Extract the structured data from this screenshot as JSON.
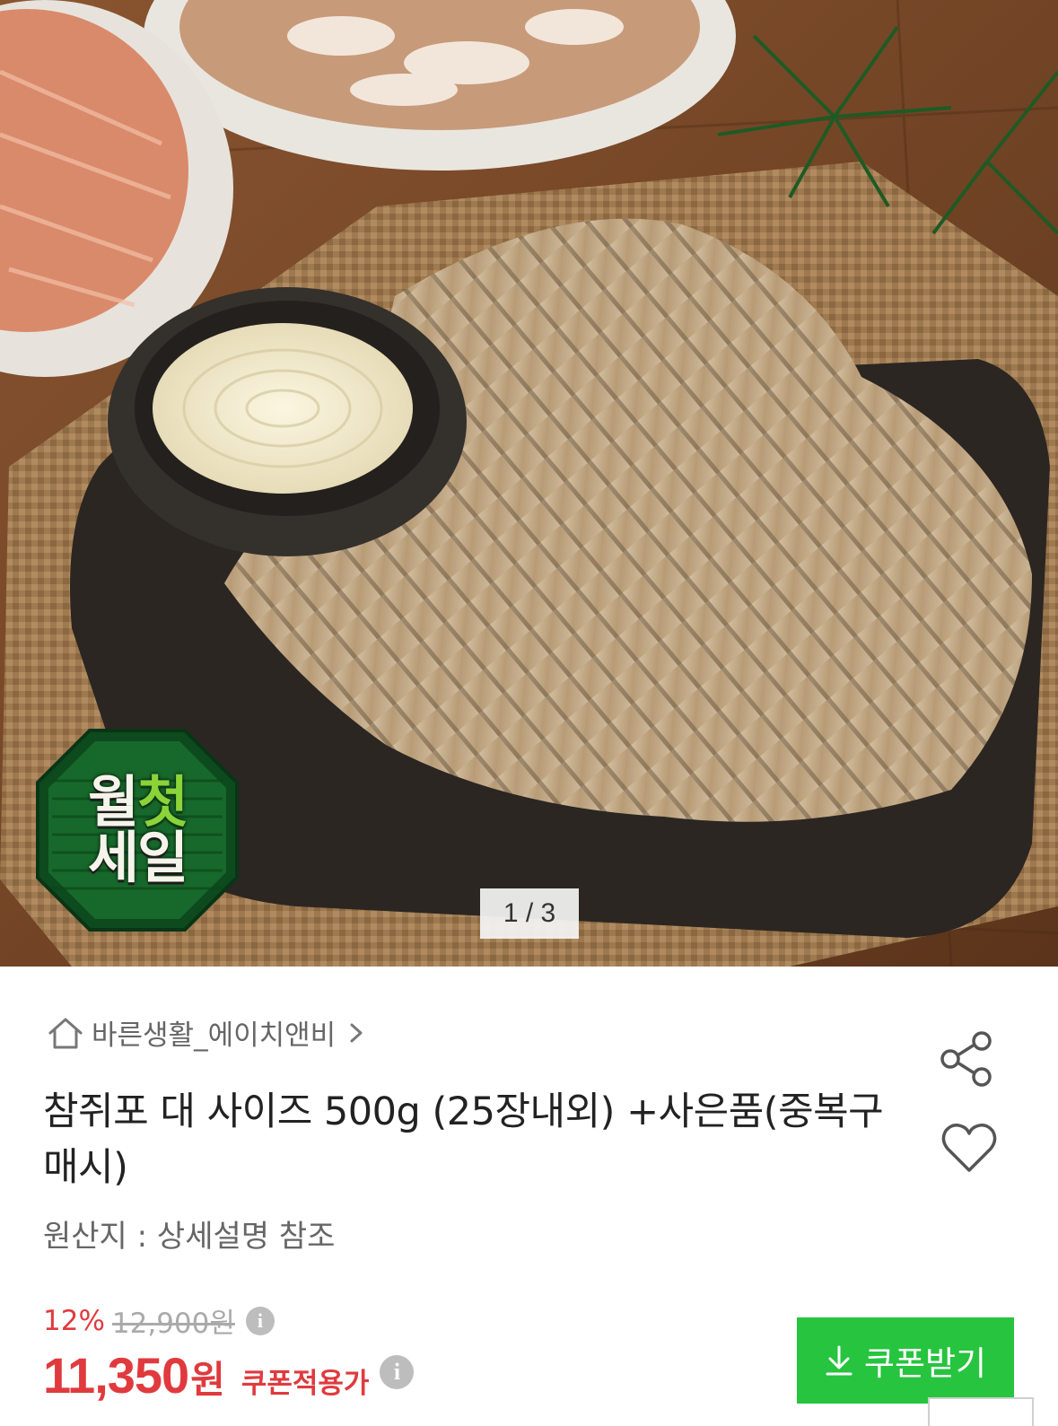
{
  "gallery": {
    "pager_text": "1 / 3",
    "badge_line1_a": "월",
    "badge_line1_b": "첫",
    "badge_line2": "세일"
  },
  "product": {
    "seller": "바른생활_에이치앤비",
    "title": "참쥐포 대 사이즈 500g (25장내외) +사은품(중복구매시)",
    "origin": "원산지 : 상세설명 참조"
  },
  "pricing": {
    "discount_percent": "12%",
    "original_price": "12,900원",
    "final_price": "11,350",
    "final_unit": "원",
    "coupon_note": "쿠폰적용가",
    "info_glyph": "i"
  },
  "actions": {
    "coupon_button": "쿠폰받기"
  },
  "colors": {
    "accent_red": "#e03a3e",
    "coupon_green": "#27c43f"
  },
  "icons": [
    "home-icon",
    "chevron-right-icon",
    "share-icon",
    "heart-icon",
    "info-icon",
    "download-icon"
  ]
}
